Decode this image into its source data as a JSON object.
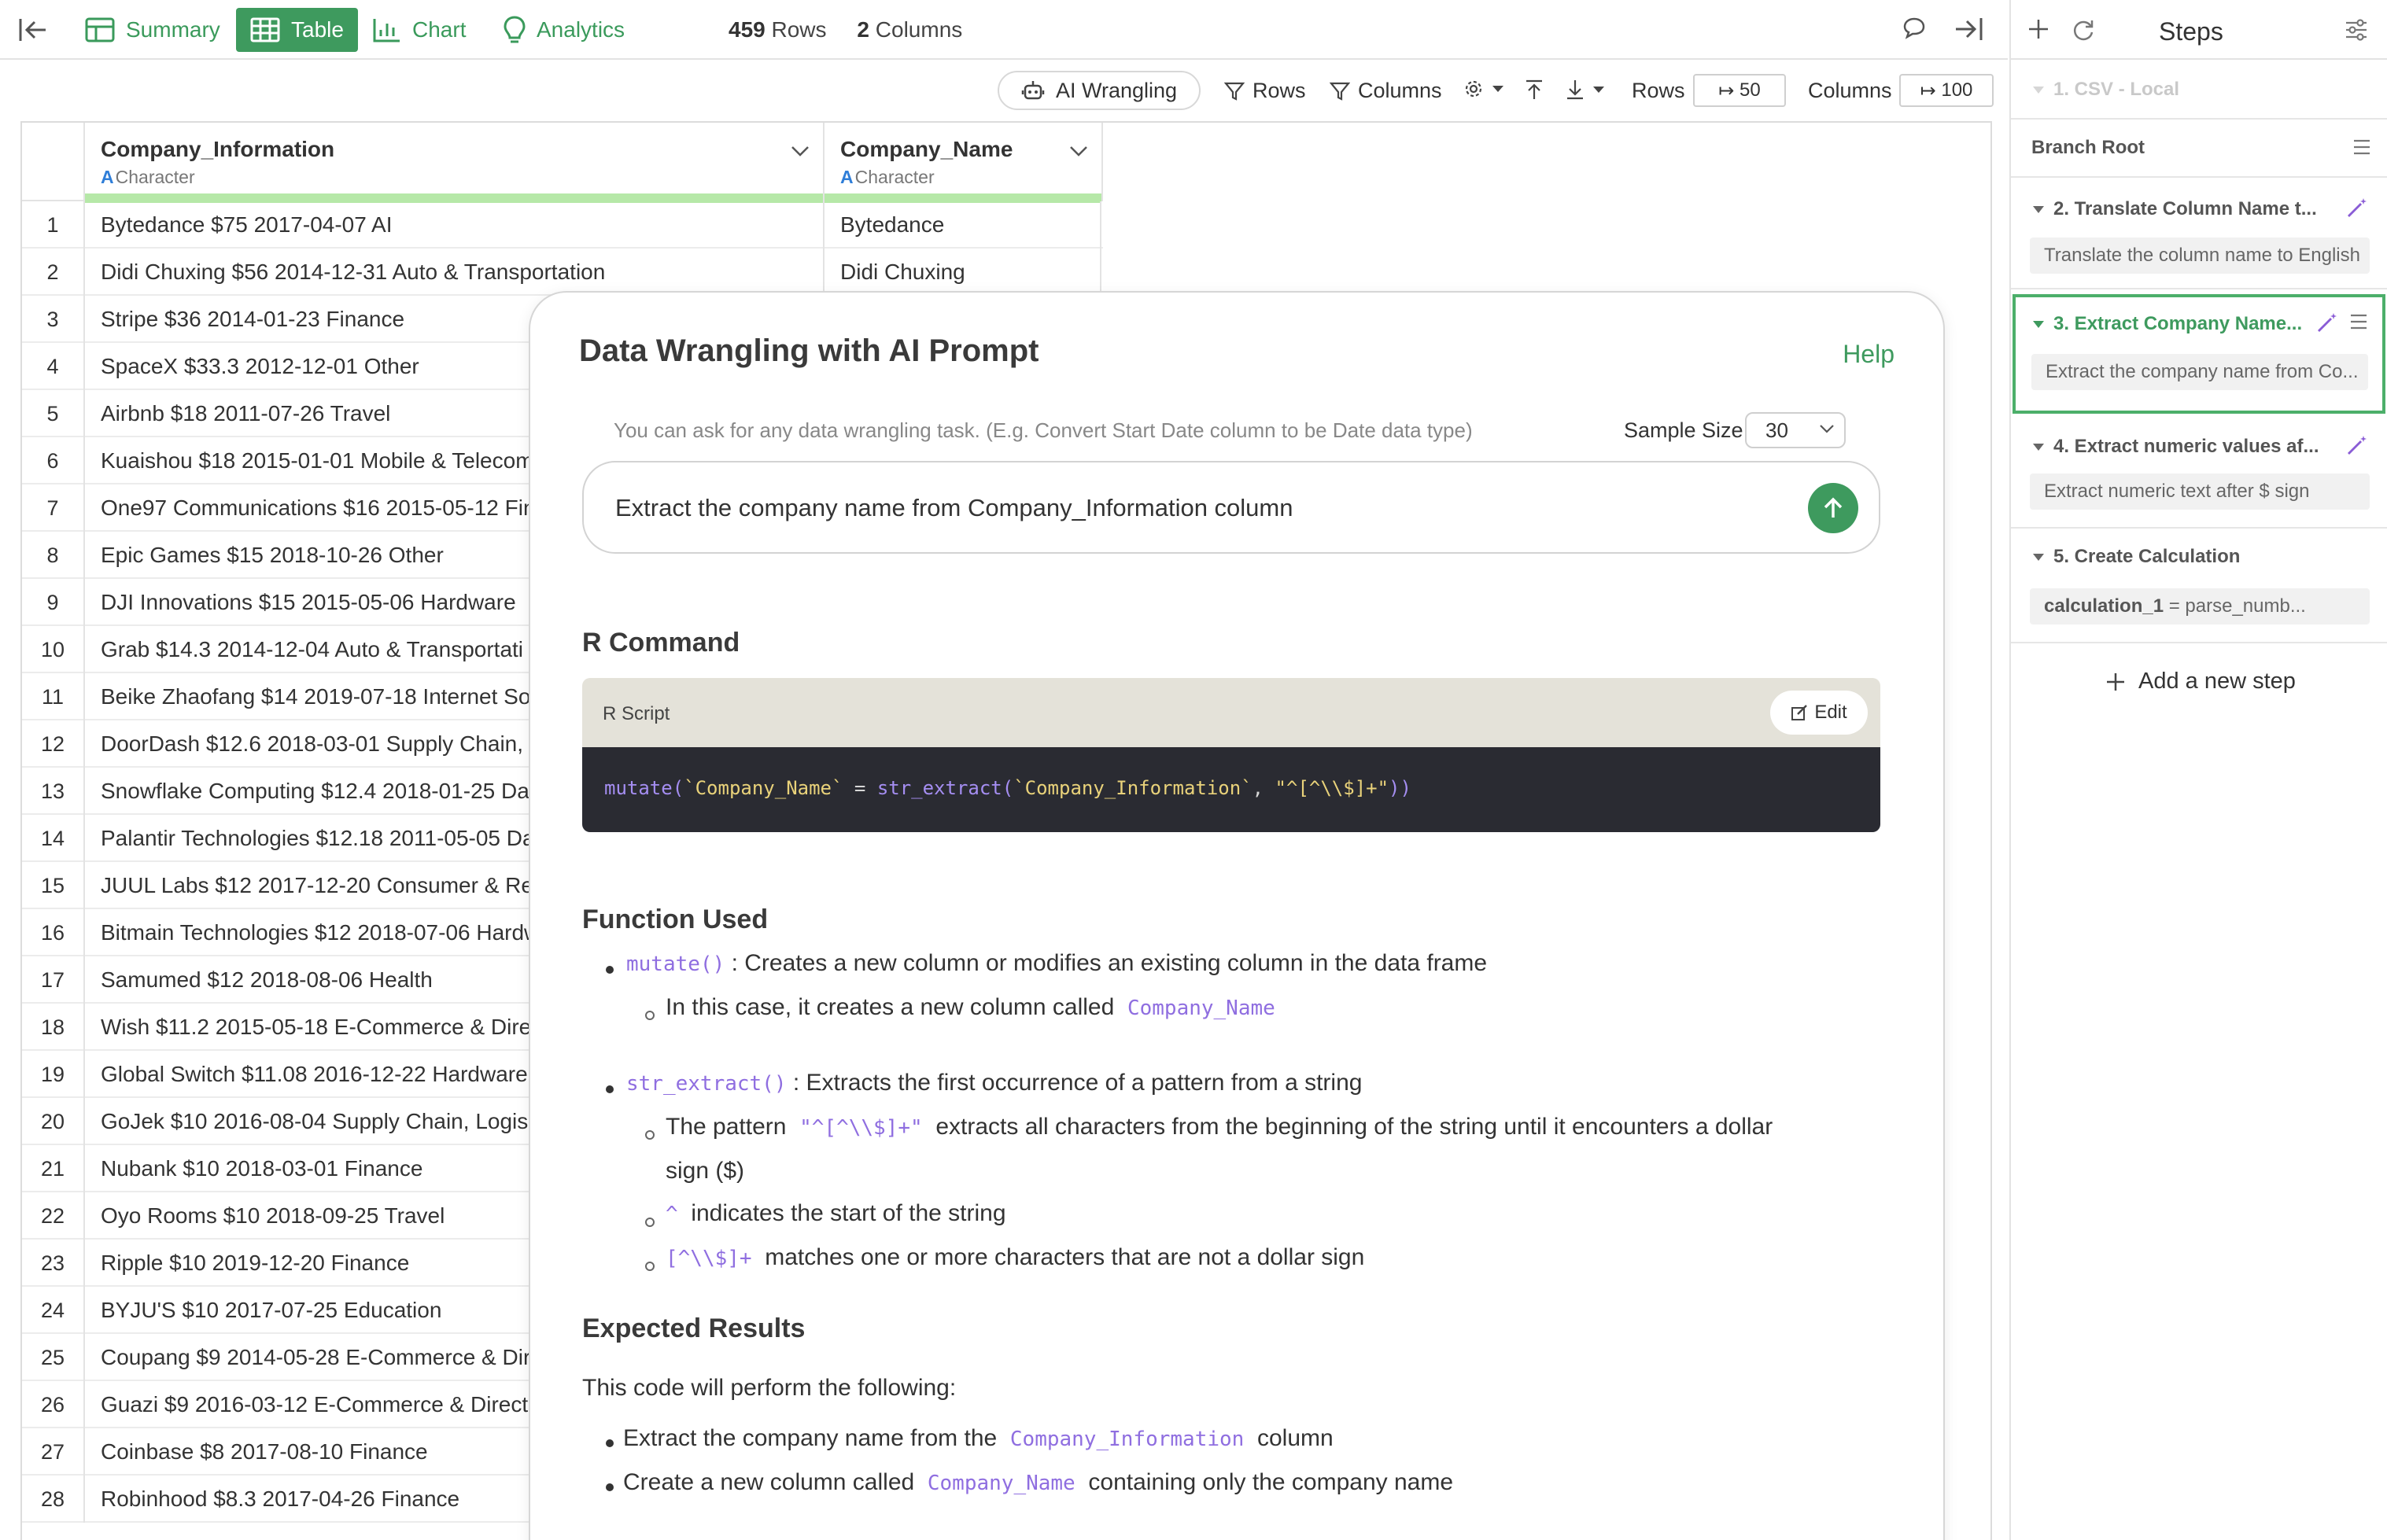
{
  "topbar": {
    "tabs": [
      {
        "label": "Summary",
        "icon": "summary-icon"
      },
      {
        "label": "Table",
        "icon": "table-icon",
        "active": true
      },
      {
        "label": "Chart",
        "icon": "chart-icon"
      },
      {
        "label": "Analytics",
        "icon": "lightbulb-icon"
      }
    ],
    "rows_count": "459",
    "rows_label": "Rows",
    "cols_count": "2",
    "cols_label": "Columns"
  },
  "toolbar": {
    "ai_wrangling": "AI Wrangling",
    "rows_filter": "Rows",
    "columns_filter": "Columns",
    "rows_label": "Rows",
    "rows_value": "50",
    "columns_label": "Columns",
    "columns_value": "100"
  },
  "grid": {
    "columns": [
      {
        "name": "Company_Information",
        "type": "Character"
      },
      {
        "name": "Company_Name",
        "type": "Character"
      }
    ],
    "rows": [
      {
        "n": "1",
        "info": "Bytedance $75 2017-04-07 AI",
        "name": "Bytedance"
      },
      {
        "n": "2",
        "info": "Didi Chuxing $56 2014-12-31 Auto & Transportation",
        "name": "Didi Chuxing"
      },
      {
        "n": "3",
        "info": "Stripe $36 2014-01-23 Finance",
        "name": ""
      },
      {
        "n": "4",
        "info": "SpaceX $33.3 2012-12-01 Other",
        "name": ""
      },
      {
        "n": "5",
        "info": "Airbnb $18 2011-07-26 Travel",
        "name": ""
      },
      {
        "n": "6",
        "info": "Kuaishou $18 2015-01-01 Mobile & Telecom",
        "name": ""
      },
      {
        "n": "7",
        "info": "One97 Communications $16 2015-05-12 Fin",
        "name": ""
      },
      {
        "n": "8",
        "info": "Epic Games $15 2018-10-26 Other",
        "name": ""
      },
      {
        "n": "9",
        "info": "DJI Innovations $15 2015-05-06 Hardware",
        "name": ""
      },
      {
        "n": "10",
        "info": "Grab $14.3 2014-12-04 Auto & Transportati",
        "name": ""
      },
      {
        "n": "11",
        "info": "Beike Zhaofang $14 2019-07-18 Internet So",
        "name": ""
      },
      {
        "n": "12",
        "info": "DoorDash $12.6 2018-03-01 Supply Chain,",
        "name": ""
      },
      {
        "n": "13",
        "info": "Snowflake Computing $12.4 2018-01-25 Da",
        "name": ""
      },
      {
        "n": "14",
        "info": "Palantir Technologies $12.18 2011-05-05 Da",
        "name": ""
      },
      {
        "n": "15",
        "info": "JUUL Labs $12 2017-12-20 Consumer & Re",
        "name": ""
      },
      {
        "n": "16",
        "info": "Bitmain Technologies $12 2018-07-06 Hardw",
        "name": ""
      },
      {
        "n": "17",
        "info": "Samumed $12 2018-08-06 Health",
        "name": ""
      },
      {
        "n": "18",
        "info": "Wish $11.2 2015-05-18 E-Commerce & Dire",
        "name": ""
      },
      {
        "n": "19",
        "info": "Global Switch $11.08 2016-12-22 Hardware",
        "name": ""
      },
      {
        "n": "20",
        "info": "GoJek $10 2016-08-04 Supply Chain, Logis",
        "name": ""
      },
      {
        "n": "21",
        "info": "Nubank $10 2018-03-01 Finance",
        "name": ""
      },
      {
        "n": "22",
        "info": "Oyo Rooms $10 2018-09-25 Travel",
        "name": ""
      },
      {
        "n": "23",
        "info": "Ripple $10 2019-12-20 Finance",
        "name": ""
      },
      {
        "n": "24",
        "info": "BYJU'S $10 2017-07-25 Education",
        "name": ""
      },
      {
        "n": "25",
        "info": "Coupang $9 2014-05-28 E-Commerce & Dir",
        "name": ""
      },
      {
        "n": "26",
        "info": "Guazi $9 2016-03-12 E-Commerce & Direct-",
        "name": ""
      },
      {
        "n": "27",
        "info": "Coinbase $8 2017-08-10 Finance",
        "name": ""
      },
      {
        "n": "28",
        "info": "Robinhood $8.3 2017-04-26 Finance",
        "name": ""
      }
    ]
  },
  "modal": {
    "title": "Data Wrangling with AI Prompt",
    "help": "Help",
    "hint": "You can ask for any data wrangling task. (E.g. Convert Start Date column to be Date data type)",
    "sample_size_label": "Sample Size",
    "sample_size_value": "30",
    "prompt": "Extract the company name from Company_Information column",
    "r_command_title": "R Command",
    "script_label": "R Script",
    "edit_label": "Edit",
    "code": {
      "fn1": "mutate(",
      "arg1": "`Company_Name`",
      "eq": " = ",
      "fn2": "str_extract(",
      "arg2": "`Company_Information`",
      "comma": ", ",
      "arg3": "\"^[^\\\\$]+\"",
      "close": "))"
    },
    "function_used_title": "Function Used",
    "func1": {
      "name": "mutate()",
      "desc": " : Creates a new column or modifies an existing column in the data frame",
      "sub1_text": "In this case, it creates a new column called",
      "sub1_code": "Company_Name"
    },
    "func2": {
      "name": "str_extract()",
      "desc": " : Extracts the first occurrence of a pattern from a string",
      "sub1_pre": "The pattern",
      "sub1_code": "\"^[^\\\\$]+\"",
      "sub1_post": "extracts all characters from the beginning of the string until it encounters a dollar",
      "sub1_cont": "sign ($)",
      "sub2_code": "^",
      "sub2_text": "indicates the start of the string",
      "sub3_code": "[^\\\\$]+",
      "sub3_text": "matches one or more characters that are not a dollar sign"
    },
    "expected_title": "Expected Results",
    "expected_intro": "This code will perform the following:",
    "expected1_pre": "Extract the company name from the",
    "expected1_code": "Company_Information",
    "expected1_post": "column",
    "expected2_pre": "Create a new column called",
    "expected2_code": "Company_Name",
    "expected2_post": "containing only the company name"
  },
  "steps": {
    "title": "Steps",
    "items": [
      {
        "title": "1. CSV - Local",
        "desc": ""
      },
      {
        "title": "Branch Root",
        "desc": ""
      },
      {
        "title": "2. Translate Column Name t...",
        "desc": "Translate the column name to English"
      },
      {
        "title": "3. Extract Company Name...",
        "desc": "Extract the company name from Co..."
      },
      {
        "title": "4. Extract numeric values af...",
        "desc": "Extract numeric text after $ sign"
      },
      {
        "title": "5. Create Calculation",
        "desc_key": "calculation_1",
        "desc_val": " = parse_numb..."
      }
    ],
    "add_step": "Add a new step"
  },
  "colors": {
    "accent_green": "#3e9a5e",
    "code_purple": "#8f6ee0",
    "code_bg": "#2a2b32",
    "ai_purple": "#8a5cd6"
  }
}
